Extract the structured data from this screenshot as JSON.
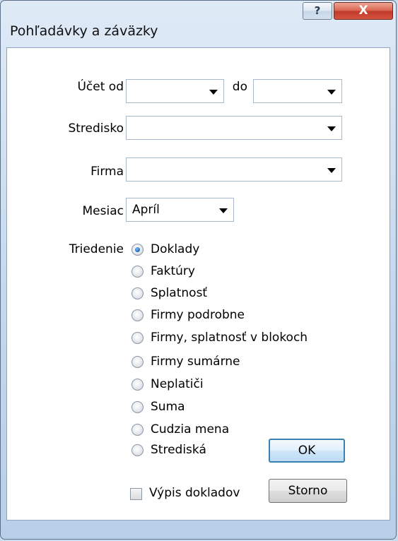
{
  "window": {
    "title": "Pohľadávky a záväzky",
    "help_glyph": "?",
    "close_glyph": "X"
  },
  "form": {
    "ucet_od_label": "Účet od",
    "ucet_od_value": "",
    "do_label": "do",
    "do_value": "",
    "stredisko_label": "Stredisko",
    "stredisko_value": "",
    "firma_label": "Firma",
    "firma_value": "",
    "mesiac_label": "Mesiac",
    "mesiac_value": "Apríl",
    "triedenie_label": "Triedenie"
  },
  "sort_options": [
    {
      "label": "Doklady",
      "checked": true
    },
    {
      "label": "Faktúry",
      "checked": false
    },
    {
      "label": "Splatnosť",
      "checked": false
    },
    {
      "label": "Firmy podrobne",
      "checked": false
    },
    {
      "label": "Firmy, splatnosť v blokoch",
      "checked": false
    },
    {
      "label": "Firmy sumárne",
      "checked": false
    },
    {
      "label": "Neplatiči",
      "checked": false
    },
    {
      "label": "Suma",
      "checked": false
    },
    {
      "label": "Cudzia mena",
      "checked": false
    },
    {
      "label": "Strediská",
      "checked": false
    }
  ],
  "vypis_dokladov": {
    "label": "Výpis dokladov",
    "checked": false
  },
  "buttons": {
    "ok": "OK",
    "storno": "Storno"
  }
}
